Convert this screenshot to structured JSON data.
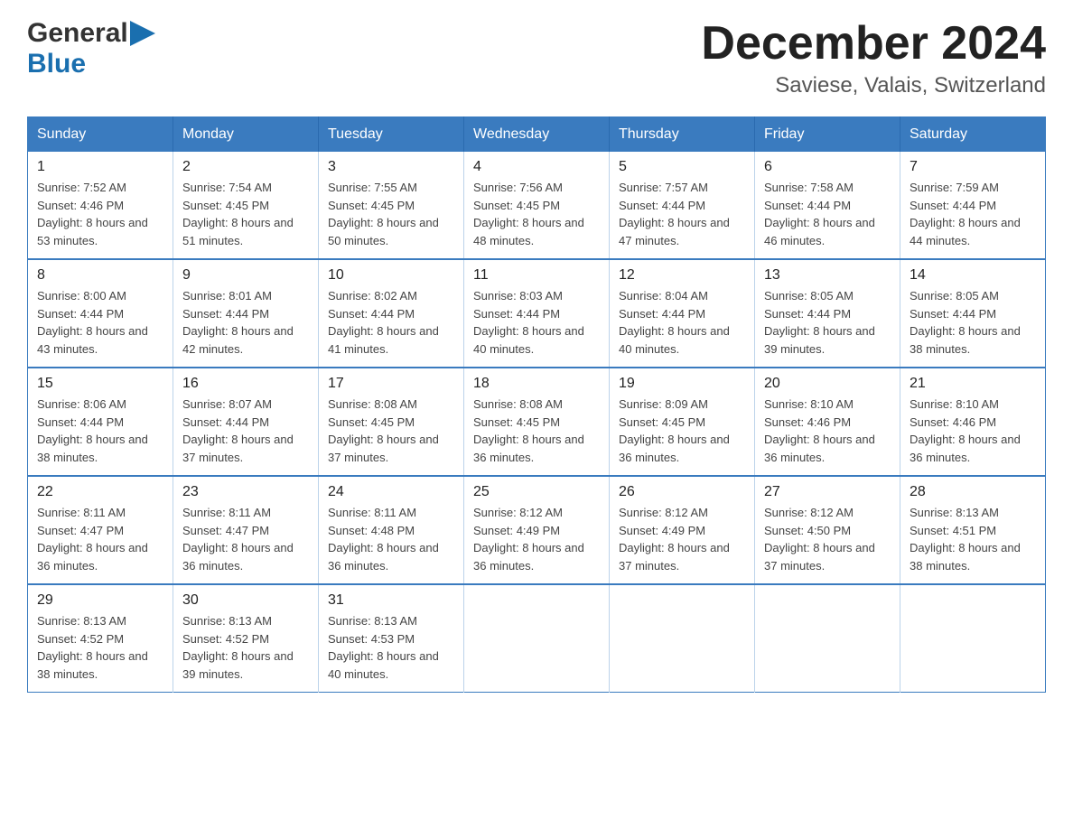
{
  "header": {
    "title": "December 2024",
    "subtitle": "Saviese, Valais, Switzerland",
    "logo_general": "General",
    "logo_blue": "Blue"
  },
  "weekdays": [
    "Sunday",
    "Monday",
    "Tuesday",
    "Wednesday",
    "Thursday",
    "Friday",
    "Saturday"
  ],
  "weeks": [
    [
      {
        "day": "1",
        "sunrise": "7:52 AM",
        "sunset": "4:46 PM",
        "daylight": "8 hours and 53 minutes."
      },
      {
        "day": "2",
        "sunrise": "7:54 AM",
        "sunset": "4:45 PM",
        "daylight": "8 hours and 51 minutes."
      },
      {
        "day": "3",
        "sunrise": "7:55 AM",
        "sunset": "4:45 PM",
        "daylight": "8 hours and 50 minutes."
      },
      {
        "day": "4",
        "sunrise": "7:56 AM",
        "sunset": "4:45 PM",
        "daylight": "8 hours and 48 minutes."
      },
      {
        "day": "5",
        "sunrise": "7:57 AM",
        "sunset": "4:44 PM",
        "daylight": "8 hours and 47 minutes."
      },
      {
        "day": "6",
        "sunrise": "7:58 AM",
        "sunset": "4:44 PM",
        "daylight": "8 hours and 46 minutes."
      },
      {
        "day": "7",
        "sunrise": "7:59 AM",
        "sunset": "4:44 PM",
        "daylight": "8 hours and 44 minutes."
      }
    ],
    [
      {
        "day": "8",
        "sunrise": "8:00 AM",
        "sunset": "4:44 PM",
        "daylight": "8 hours and 43 minutes."
      },
      {
        "day": "9",
        "sunrise": "8:01 AM",
        "sunset": "4:44 PM",
        "daylight": "8 hours and 42 minutes."
      },
      {
        "day": "10",
        "sunrise": "8:02 AM",
        "sunset": "4:44 PM",
        "daylight": "8 hours and 41 minutes."
      },
      {
        "day": "11",
        "sunrise": "8:03 AM",
        "sunset": "4:44 PM",
        "daylight": "8 hours and 40 minutes."
      },
      {
        "day": "12",
        "sunrise": "8:04 AM",
        "sunset": "4:44 PM",
        "daylight": "8 hours and 40 minutes."
      },
      {
        "day": "13",
        "sunrise": "8:05 AM",
        "sunset": "4:44 PM",
        "daylight": "8 hours and 39 minutes."
      },
      {
        "day": "14",
        "sunrise": "8:05 AM",
        "sunset": "4:44 PM",
        "daylight": "8 hours and 38 minutes."
      }
    ],
    [
      {
        "day": "15",
        "sunrise": "8:06 AM",
        "sunset": "4:44 PM",
        "daylight": "8 hours and 38 minutes."
      },
      {
        "day": "16",
        "sunrise": "8:07 AM",
        "sunset": "4:44 PM",
        "daylight": "8 hours and 37 minutes."
      },
      {
        "day": "17",
        "sunrise": "8:08 AM",
        "sunset": "4:45 PM",
        "daylight": "8 hours and 37 minutes."
      },
      {
        "day": "18",
        "sunrise": "8:08 AM",
        "sunset": "4:45 PM",
        "daylight": "8 hours and 36 minutes."
      },
      {
        "day": "19",
        "sunrise": "8:09 AM",
        "sunset": "4:45 PM",
        "daylight": "8 hours and 36 minutes."
      },
      {
        "day": "20",
        "sunrise": "8:10 AM",
        "sunset": "4:46 PM",
        "daylight": "8 hours and 36 minutes."
      },
      {
        "day": "21",
        "sunrise": "8:10 AM",
        "sunset": "4:46 PM",
        "daylight": "8 hours and 36 minutes."
      }
    ],
    [
      {
        "day": "22",
        "sunrise": "8:11 AM",
        "sunset": "4:47 PM",
        "daylight": "8 hours and 36 minutes."
      },
      {
        "day": "23",
        "sunrise": "8:11 AM",
        "sunset": "4:47 PM",
        "daylight": "8 hours and 36 minutes."
      },
      {
        "day": "24",
        "sunrise": "8:11 AM",
        "sunset": "4:48 PM",
        "daylight": "8 hours and 36 minutes."
      },
      {
        "day": "25",
        "sunrise": "8:12 AM",
        "sunset": "4:49 PM",
        "daylight": "8 hours and 36 minutes."
      },
      {
        "day": "26",
        "sunrise": "8:12 AM",
        "sunset": "4:49 PM",
        "daylight": "8 hours and 37 minutes."
      },
      {
        "day": "27",
        "sunrise": "8:12 AM",
        "sunset": "4:50 PM",
        "daylight": "8 hours and 37 minutes."
      },
      {
        "day": "28",
        "sunrise": "8:13 AM",
        "sunset": "4:51 PM",
        "daylight": "8 hours and 38 minutes."
      }
    ],
    [
      {
        "day": "29",
        "sunrise": "8:13 AM",
        "sunset": "4:52 PM",
        "daylight": "8 hours and 38 minutes."
      },
      {
        "day": "30",
        "sunrise": "8:13 AM",
        "sunset": "4:52 PM",
        "daylight": "8 hours and 39 minutes."
      },
      {
        "day": "31",
        "sunrise": "8:13 AM",
        "sunset": "4:53 PM",
        "daylight": "8 hours and 40 minutes."
      },
      null,
      null,
      null,
      null
    ]
  ],
  "labels": {
    "sunrise": "Sunrise:",
    "sunset": "Sunset:",
    "daylight": "Daylight:"
  }
}
